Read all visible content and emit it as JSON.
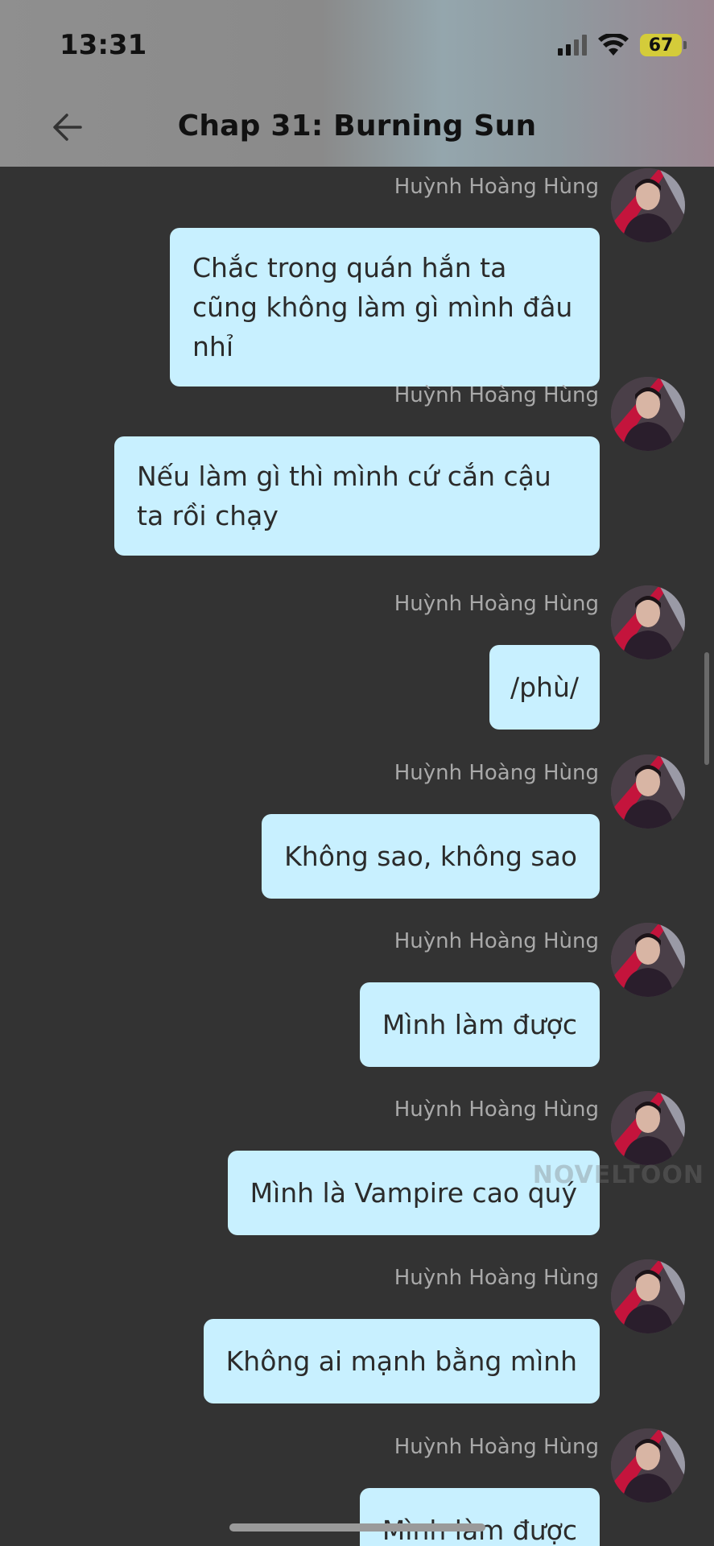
{
  "status_bar": {
    "time": "13:31",
    "battery": "67"
  },
  "header": {
    "title": "Chap 31: Burning Sun"
  },
  "messages": [
    {
      "sender": "Huỳnh Hoàng Hùng",
      "text": "Chắc trong quán hắn ta cũng không làm gì mình đâu nhỉ"
    },
    {
      "sender": "Huỳnh Hoàng Hùng",
      "text": "Nếu làm gì thì mình cứ cắn cậu ta rồi chạy"
    },
    {
      "sender": "Huỳnh Hoàng Hùng",
      "text": "/phù/"
    },
    {
      "sender": "Huỳnh Hoàng Hùng",
      "text": "Không sao, không sao"
    },
    {
      "sender": "Huỳnh Hoàng Hùng",
      "text": "Mình làm được"
    },
    {
      "sender": "Huỳnh Hoàng Hùng",
      "text": "Mình là Vampire cao quý"
    },
    {
      "sender": "Huỳnh Hoàng Hùng",
      "text": "Không ai mạnh bằng mình"
    },
    {
      "sender": "Huỳnh Hoàng Hùng",
      "text": "Mình làm được"
    }
  ],
  "watermark": "NOVELTOON",
  "icons": {
    "back": "arrow-left-icon",
    "wifi": "wifi-icon",
    "signal": "signal-icon",
    "battery": "battery-icon"
  }
}
